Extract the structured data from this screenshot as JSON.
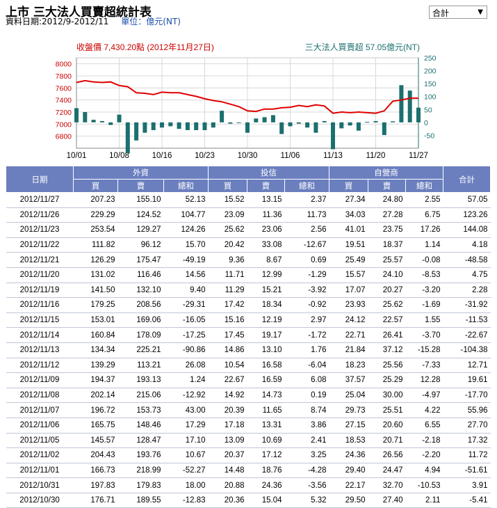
{
  "header": {
    "title": "上市 三大法人買賣超統計表",
    "date_range": "資料日期:2012/9-2012/11",
    "unit": "單位：億元(NT)",
    "select_value": "合計"
  },
  "chart_data": {
    "type": "bar",
    "left_title": "收盤價 7,430.20點 (2012年11月27日)",
    "right_title": "三大法人買賣超 57.05億元(NT)",
    "colors": {
      "price_line": "#e00000",
      "bars": "#1c6f6f",
      "left_axis": "#cc0000",
      "right_axis": "#1c6f6f"
    },
    "y_left_ticks": [
      "8000",
      "7800",
      "7600",
      "7400",
      "7200",
      "7000",
      "6800"
    ],
    "y_right_ticks": [
      "250",
      "200",
      "150",
      "100",
      "50",
      "0",
      "-50"
    ],
    "ylim_left": [
      6600,
      8100
    ],
    "ylim_right": [
      -100,
      250
    ],
    "x_labels": [
      "10/01",
      "10/08",
      "10/16",
      "10/23",
      "10/30",
      "11/06",
      "11/13",
      "11/20",
      "11/27"
    ],
    "x_label_index": [
      0,
      5,
      10,
      15,
      20,
      25,
      30,
      35,
      40
    ],
    "price": [
      7690,
      7720,
      7700,
      7690,
      7700,
      7640,
      7620,
      7520,
      7510,
      7490,
      7530,
      7520,
      7520,
      7490,
      7460,
      7420,
      7390,
      7370,
      7330,
      7290,
      7220,
      7210,
      7250,
      7250,
      7270,
      7280,
      7310,
      7290,
      7320,
      7300,
      7180,
      7200,
      7190,
      7200,
      7190,
      7180,
      7220,
      7380,
      7400,
      7430,
      7430
    ],
    "net_flow": [
      55,
      40,
      10,
      5,
      -10,
      30,
      -120,
      -70,
      -40,
      -30,
      -20,
      -15,
      -25,
      -30,
      -30,
      -30,
      -20,
      45,
      -5,
      0,
      -40,
      15,
      20,
      28,
      -45,
      -15,
      -5,
      -20,
      -40,
      5,
      -104,
      -23,
      -12,
      -32,
      2,
      5,
      -49,
      4,
      144,
      123,
      57
    ]
  },
  "table": {
    "header_groups": [
      "外資",
      "投信",
      "自營商"
    ],
    "col_date": "日期",
    "col_total": "合計",
    "sub_headers": [
      "買",
      "賣",
      "總和",
      "買",
      "賣",
      "總和",
      "買",
      "賣",
      "總和"
    ],
    "rows": [
      [
        "2012/11/27",
        "207.23",
        "155.10",
        "52.13",
        "15.52",
        "13.15",
        "2.37",
        "27.34",
        "24.80",
        "2.55",
        "57.05"
      ],
      [
        "2012/11/26",
        "229.29",
        "124.52",
        "104.77",
        "23.09",
        "11.36",
        "11.73",
        "34.03",
        "27.28",
        "6.75",
        "123.26"
      ],
      [
        "2012/11/23",
        "253.54",
        "129.27",
        "124.26",
        "25.62",
        "23.06",
        "2.56",
        "41.01",
        "23.75",
        "17.26",
        "144.08"
      ],
      [
        "2012/11/22",
        "111.82",
        "96.12",
        "15.70",
        "20.42",
        "33.08",
        "-12.67",
        "19.51",
        "18.37",
        "1.14",
        "4.18"
      ],
      [
        "2012/11/21",
        "126.29",
        "175.47",
        "-49.19",
        "9.36",
        "8.67",
        "0.69",
        "25.49",
        "25.57",
        "-0.08",
        "-48.58"
      ],
      [
        "2012/11/20",
        "131.02",
        "116.46",
        "14.56",
        "11.71",
        "12.99",
        "-1.29",
        "15.57",
        "24.10",
        "-8.53",
        "4.75"
      ],
      [
        "2012/11/19",
        "141.50",
        "132.10",
        "9.40",
        "11.29",
        "15.21",
        "-3.92",
        "17.07",
        "20.27",
        "-3.20",
        "2.28"
      ],
      [
        "2012/11/16",
        "179.25",
        "208.56",
        "-29.31",
        "17.42",
        "18.34",
        "-0.92",
        "23.93",
        "25.62",
        "-1.69",
        "-31.92"
      ],
      [
        "2012/11/15",
        "153.01",
        "169.06",
        "-16.05",
        "15.16",
        "12.19",
        "2.97",
        "24.12",
        "22.57",
        "1.55",
        "-11.53"
      ],
      [
        "2012/11/14",
        "160.84",
        "178.09",
        "-17.25",
        "17.45",
        "19.17",
        "-1.72",
        "22.71",
        "26.41",
        "-3.70",
        "-22.67"
      ],
      [
        "2012/11/13",
        "134.34",
        "225.21",
        "-90.86",
        "14.86",
        "13.10",
        "1.76",
        "21.84",
        "37.12",
        "-15.28",
        "-104.38"
      ],
      [
        "2012/11/12",
        "139.29",
        "113.21",
        "26.08",
        "10.54",
        "16.58",
        "-6.04",
        "18.23",
        "25.56",
        "-7.33",
        "12.71"
      ],
      [
        "2012/11/09",
        "194.37",
        "193.13",
        "1.24",
        "22.67",
        "16.59",
        "6.08",
        "37.57",
        "25.29",
        "12.28",
        "19.61"
      ],
      [
        "2012/11/08",
        "202.14",
        "215.06",
        "-12.92",
        "14.92",
        "14.73",
        "0.19",
        "25.04",
        "30.00",
        "-4.97",
        "-17.70"
      ],
      [
        "2012/11/07",
        "196.72",
        "153.73",
        "43.00",
        "20.39",
        "11.65",
        "8.74",
        "29.73",
        "25.51",
        "4.22",
        "55.96"
      ],
      [
        "2012/11/06",
        "165.75",
        "148.46",
        "17.29",
        "17.18",
        "13.31",
        "3.86",
        "27.15",
        "20.60",
        "6.55",
        "27.70"
      ],
      [
        "2012/11/05",
        "145.57",
        "128.47",
        "17.10",
        "13.09",
        "10.69",
        "2.41",
        "18.53",
        "20.71",
        "-2.18",
        "17.32"
      ],
      [
        "2012/11/02",
        "204.43",
        "193.76",
        "10.67",
        "20.37",
        "17.12",
        "3.25",
        "24.36",
        "26.56",
        "-2.20",
        "11.72"
      ],
      [
        "2012/11/01",
        "166.73",
        "218.99",
        "-52.27",
        "14.48",
        "18.76",
        "-4.28",
        "29.40",
        "24.47",
        "4.94",
        "-51.61"
      ],
      [
        "2012/10/31",
        "197.83",
        "179.83",
        "18.00",
        "20.88",
        "24.36",
        "-3.56",
        "22.17",
        "32.70",
        "-10.53",
        "3.91"
      ],
      [
        "2012/10/30",
        "176.71",
        "189.55",
        "-12.83",
        "20.36",
        "15.04",
        "5.32",
        "29.50",
        "27.40",
        "2.11",
        "-5.41"
      ]
    ]
  }
}
